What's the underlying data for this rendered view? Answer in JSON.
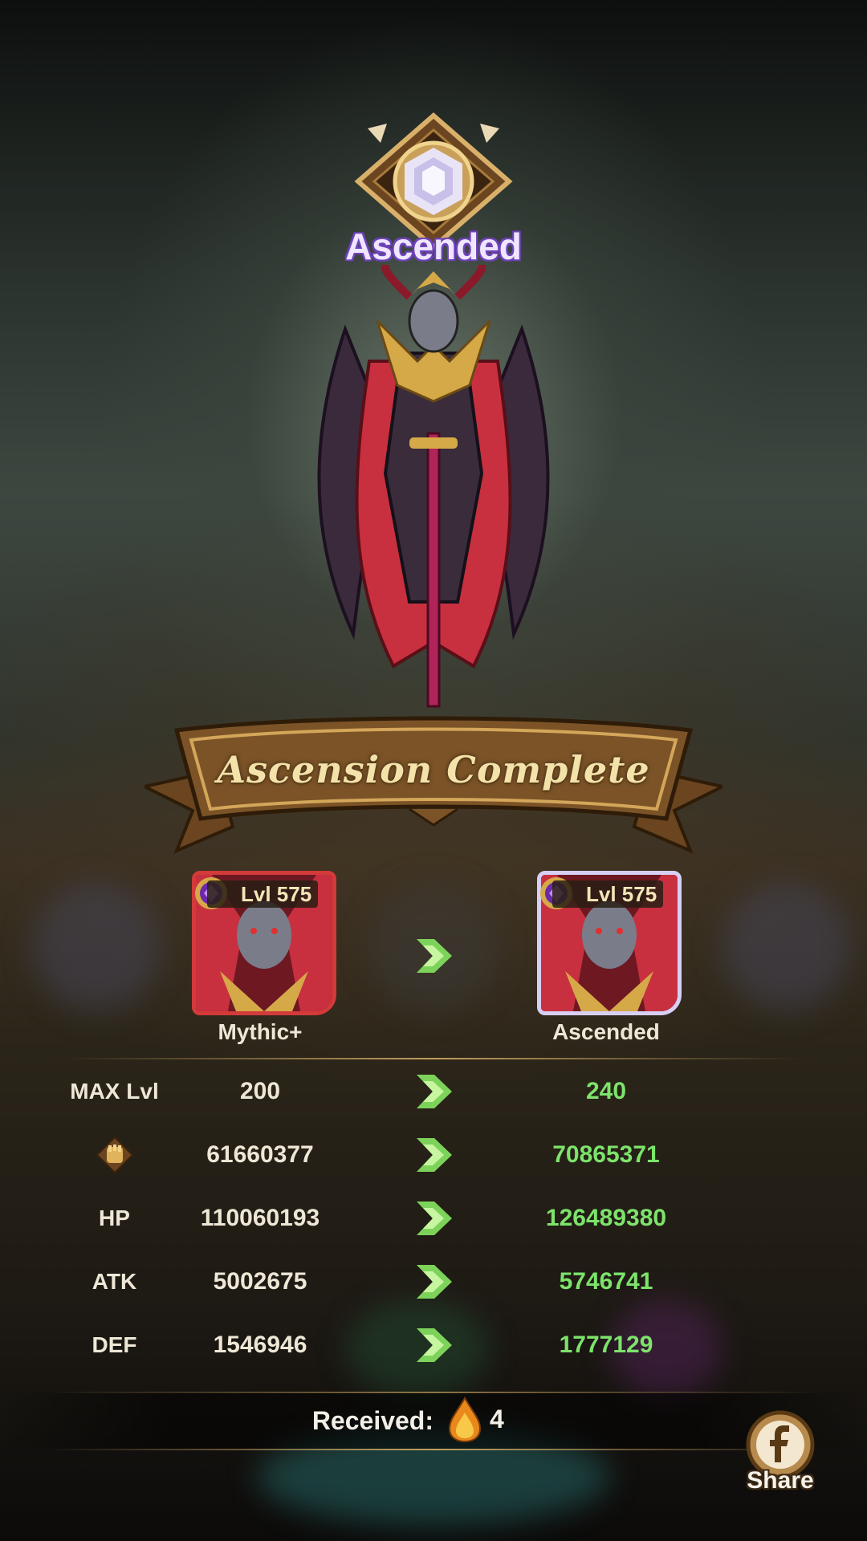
{
  "badge": {
    "title": "Ascended",
    "icon": "diamond-gem-icon"
  },
  "banner": {
    "title": "Ascension Complete"
  },
  "portraits": {
    "left": {
      "level": "Lvl 575",
      "tier": "Mythic+",
      "frame_color": "#d33a3a"
    },
    "right": {
      "level": "Lvl 575",
      "tier": "Ascended",
      "frame_color": "#d8cff5"
    }
  },
  "stats": [
    {
      "label": "MAX Lvl",
      "old": "200",
      "new": "240"
    },
    {
      "label": "",
      "icon": "power-fist-icon",
      "old": "61660377",
      "new": "70865371"
    },
    {
      "label": "HP",
      "old": "110060193",
      "new": "126489380"
    },
    {
      "label": "ATK",
      "old": "5002675",
      "new": "5746741"
    },
    {
      "label": "DEF",
      "old": "1546946",
      "new": "1777129"
    }
  ],
  "received": {
    "label": "Received:",
    "icon": "flame-drop-icon",
    "count": "4"
  },
  "share": {
    "label": "Share",
    "icon": "facebook-icon"
  },
  "colors": {
    "increase": "#7de36b",
    "text": "#efe7d6",
    "accent": "#f3e2a9"
  }
}
